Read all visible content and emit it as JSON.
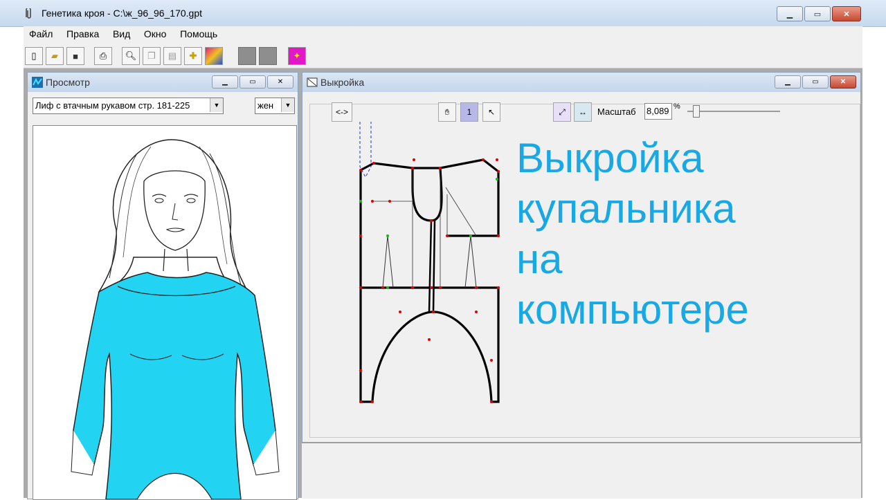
{
  "window": {
    "title": "Генетика кроя - C:\\ж_96_96_170.gpt"
  },
  "menu": [
    "Файл",
    "Правка",
    "Вид",
    "Окно",
    "Помощь"
  ],
  "toolbar_icons": [
    "new-file-icon",
    "open-folder-icon",
    "save-icon",
    "print-icon",
    "print-preview-icon",
    "copy-icon",
    "paste-icon",
    "crosshair-icon",
    "palette-icon",
    "gray-button-1",
    "gray-button-2",
    "magic-wand-icon"
  ],
  "preview": {
    "title": "Просмотр",
    "model_select": "Лиф с втачным рукавом стр. 181-225",
    "gender_select": "жен",
    "garment_color": "#22d3f2"
  },
  "pattern": {
    "title": "Выкройка",
    "mirror_label": "<->",
    "scale_label": "Масштаб",
    "scale_value": "8,089",
    "scale_unit": "%"
  },
  "overlay": {
    "lines": [
      "Выкройка",
      "купальника",
      "на",
      "компьютере"
    ],
    "color": "#18a8e4"
  }
}
